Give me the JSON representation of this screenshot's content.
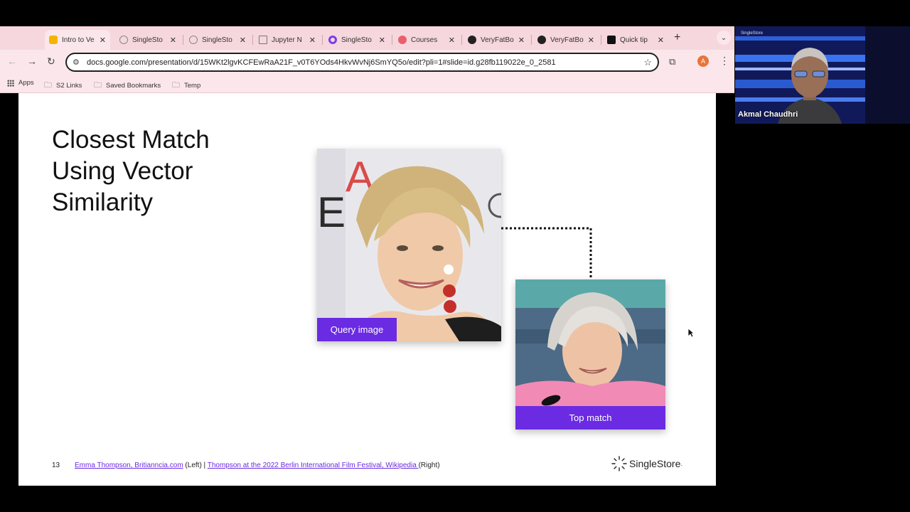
{
  "tabs": [
    {
      "title": "Intro to Ve",
      "favicon": "slides-icon",
      "active": true
    },
    {
      "title": "SingleSto",
      "favicon": "singlestore-icon",
      "active": false
    },
    {
      "title": "SingleSto",
      "favicon": "singlestore-icon",
      "active": false
    },
    {
      "title": "Jupyter N",
      "favicon": "jupyter-icon",
      "active": false
    },
    {
      "title": "SingleSto",
      "favicon": "singlestore-purple-icon",
      "active": false
    },
    {
      "title": "Courses",
      "favicon": "courses-icon",
      "active": false
    },
    {
      "title": "VeryFatBo",
      "favicon": "github-icon",
      "active": false
    },
    {
      "title": "VeryFatBo",
      "favicon": "github-icon",
      "active": false
    },
    {
      "title": "Quick tip",
      "favicon": "medium-icon",
      "active": false
    }
  ],
  "address_bar": {
    "url": "docs.google.com/presentation/d/15WKt2lgvKCFEwRaA21F_v0T6YOds4HkvWvNj6SmYQ5o/edit?pli=1#slide=id.g28fb119022e_0_2581"
  },
  "profile_initial": "A",
  "bookmarks": [
    "Apps",
    "S2 Links",
    "Saved Bookmarks",
    "Temp"
  ],
  "slide": {
    "title": "Closest Match\nUsing Vector\nSimilarity",
    "query_label": "Query image",
    "match_label": "Top match",
    "number": "13",
    "credit_left_link": "Emma Thompson, Britianncia.com",
    "credit_left_suffix": " (Left)  |  ",
    "credit_right_link": "Thompson at the 2022 Berlin International Film Festival, Wikipedia ",
    "credit_right_suffix": "(Right)",
    "brand": "SingleStore",
    "accent_color": "#6a2be2"
  },
  "webcam": {
    "name": "Akmal Chaudhri",
    "logo_text": "SingleStore"
  }
}
